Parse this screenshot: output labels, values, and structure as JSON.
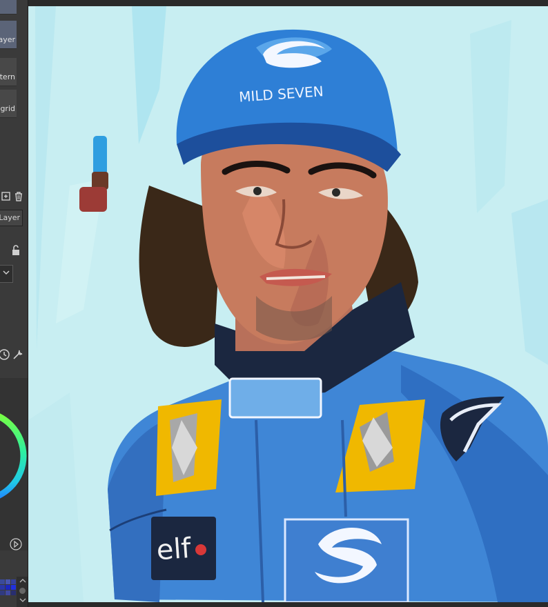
{
  "left_panel": {
    "sub_tools": [
      {
        "label": "",
        "selected": true
      },
      {
        "label": "Layer",
        "selected": true
      },
      {
        "label": "pattern",
        "selected": false
      },
      {
        "label": "grid",
        "selected": false
      }
    ],
    "layer_tab_label": "Layer",
    "icons": [
      "new-layer-icon",
      "trash-icon",
      "lock-icon",
      "chevron-down-icon",
      "history-icon",
      "wrench-icon",
      "play-icon",
      "scroll-up-icon",
      "scroll-down-icon"
    ]
  },
  "canvas": {
    "cap_text": "MILD SEVEN",
    "sponsor_text": "elf",
    "colors": {
      "background": "#c7ecf0",
      "suit_blue": "#3f86d6",
      "yellow": "#f0b800",
      "dark_navy": "#1b2740",
      "skin": "#c77b5e",
      "hair": "#3a2818"
    }
  }
}
